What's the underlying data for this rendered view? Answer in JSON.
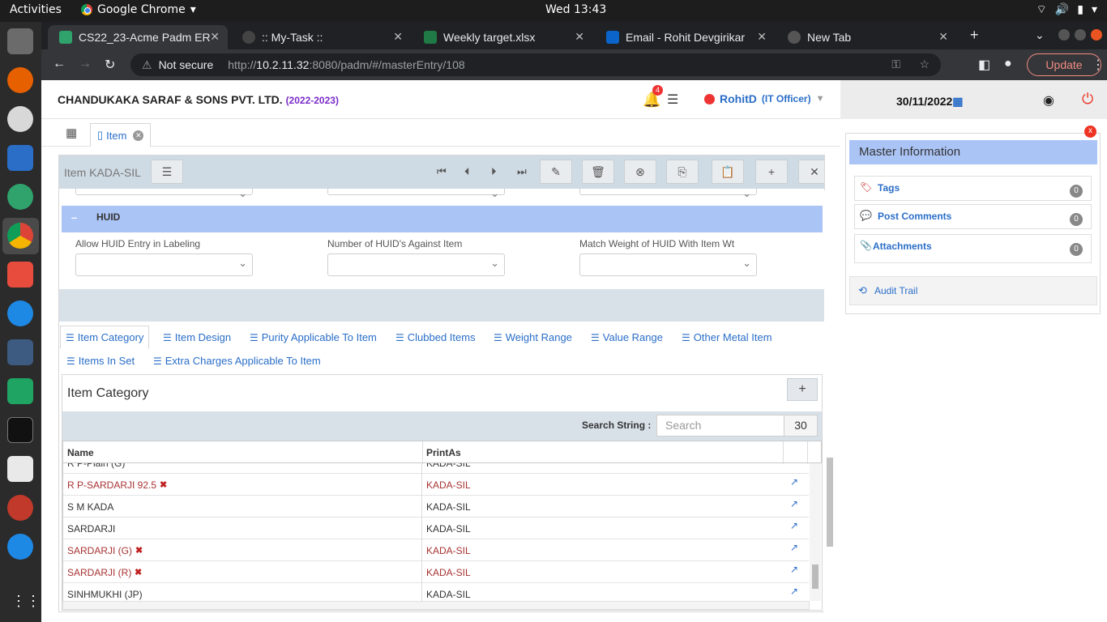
{
  "topbar": {
    "activities": "Activities",
    "app": "Google Chrome",
    "clock": "Wed 13:43"
  },
  "tabs": [
    {
      "title": "CS22_23-Acme Padm ER",
      "active": true
    },
    {
      "title": ":: My-Task ::"
    },
    {
      "title": "Weekly target.xlsx"
    },
    {
      "title": "Email - Rohit Devgirikar"
    },
    {
      "title": "New Tab"
    }
  ],
  "address": {
    "security": "Not secure",
    "url_host": "10.2.11.32",
    "url_prefix": "http://",
    "url_rest": ":8080/padm/#/masterEntry/108",
    "update_label": "Update"
  },
  "header": {
    "company": "CHANDUKAKA SARAF & SONS PVT. LTD.",
    "year": "(2022-2023)",
    "notif_count": "4",
    "user": "RohitD",
    "role": "(IT Officer)",
    "date": "30/11/2022"
  },
  "breadcrumb": {
    "tab_label": "Item"
  },
  "form": {
    "title": "Item KADA-SIL",
    "section": "HUID",
    "fields": [
      {
        "label": "Allow HUID Entry in Labeling",
        "value": ""
      },
      {
        "label": "Number of HUID's Against Item",
        "value": ""
      },
      {
        "label": "Match Weight of HUID With Item Wt",
        "value": ""
      }
    ]
  },
  "subtabs": [
    "Item Category",
    "Item Design",
    "Purity Applicable To Item",
    "Clubbed Items",
    "Weight Range",
    "Value Range",
    "Other Metal Item",
    "Items In Set",
    "Extra Charges Applicable To Item"
  ],
  "category": {
    "title": "Item Category",
    "add_label": "+",
    "search_label": "Search String :",
    "search_placeholder": "Search",
    "page_size": "30",
    "columns": [
      "Name",
      "PrintAs"
    ],
    "rows": [
      {
        "name": "R P-Plain (G)",
        "print": "KADA-SIL",
        "deleted": false
      },
      {
        "name": "R P-SARDARJI 92.5",
        "print": "KADA-SIL",
        "deleted": true
      },
      {
        "name": "S M KADA",
        "print": "KADA-SIL",
        "deleted": false
      },
      {
        "name": "SARDARJI",
        "print": "KADA-SIL",
        "deleted": false
      },
      {
        "name": "SARDARJI (G)",
        "print": "KADA-SIL",
        "deleted": true
      },
      {
        "name": "SARDARJI (R)",
        "print": "KADA-SIL",
        "deleted": true
      },
      {
        "name": "SINHMUKHI (JP)",
        "print": "KADA-SIL",
        "deleted": false
      }
    ]
  },
  "master": {
    "title": "Master Information",
    "items": [
      {
        "label": "Tags",
        "count": "0"
      },
      {
        "label": "Post Comments",
        "count": "0"
      },
      {
        "label": "Attachments",
        "count": "0"
      }
    ],
    "audit": "Audit Trail"
  }
}
